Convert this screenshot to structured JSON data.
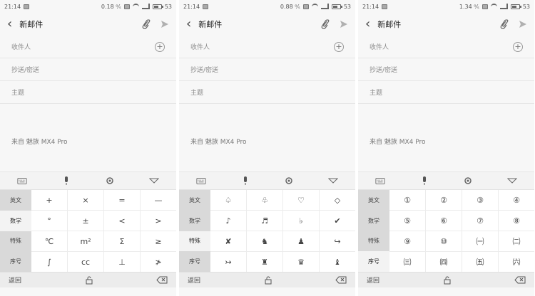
{
  "screens": [
    {
      "status": {
        "time": "21:14",
        "speed": "0.18 ⁰⁄ₛ",
        "battery": "53"
      },
      "header": {
        "title": "新邮件"
      },
      "fields": {
        "to_label": "收件人",
        "cc_label": "抄送/密送",
        "subject_label": "主题"
      },
      "signature": "来自 魅族 MX4 Pro",
      "categories": [
        "英文",
        "数学",
        "特殊",
        "序号"
      ],
      "active_category": 1,
      "keys": [
        "+",
        "×",
        "=",
        "—",
        "°",
        "±",
        "<",
        ">",
        "℃",
        "m²",
        "Σ",
        "≥",
        "∫",
        "cc",
        "⊥",
        "≯"
      ],
      "bottom": {
        "back": "返回"
      },
      "icons": {
        "keyboard": "keyboard-icon",
        "mic": "microphone-icon",
        "settings": "gear-icon",
        "collapse": "chevron-down-icon",
        "lock": "lock-icon",
        "delete": "backspace-icon",
        "attach": "paperclip-icon",
        "send": "send-icon",
        "add": "plus-circle-icon"
      }
    },
    {
      "status": {
        "time": "21:14",
        "speed": "0.88 ⁰⁄ₛ",
        "battery": "53"
      },
      "header": {
        "title": "新邮件"
      },
      "fields": {
        "to_label": "收件人",
        "cc_label": "抄送/密送",
        "subject_label": "主题"
      },
      "signature": "来自 魅族 MX4 Pro",
      "categories": [
        "英文",
        "数学",
        "特殊",
        "序号"
      ],
      "active_category": 2,
      "keys": [
        "♤",
        "♧",
        "♡",
        "◇",
        "♪",
        "♬",
        "♭",
        "✔",
        "✘",
        "♞",
        "♟",
        "↪",
        "↣",
        "♜",
        "♛",
        "♝"
      ],
      "bottom": {
        "back": "返回"
      },
      "icons": {
        "keyboard": "keyboard-icon",
        "mic": "microphone-icon",
        "settings": "gear-icon",
        "collapse": "chevron-down-icon",
        "lock": "lock-icon",
        "delete": "backspace-icon",
        "attach": "paperclip-icon",
        "send": "send-icon",
        "add": "plus-circle-icon"
      }
    },
    {
      "status": {
        "time": "21:14",
        "speed": "1.34 ⁰⁄ₛ",
        "battery": "53"
      },
      "header": {
        "title": "新邮件"
      },
      "fields": {
        "to_label": "收件人",
        "cc_label": "抄送/密送",
        "subject_label": "主题"
      },
      "signature": "来自 魅族 MX4 Pro",
      "categories": [
        "英文",
        "数学",
        "特殊",
        "序号"
      ],
      "active_category": 3,
      "keys": [
        "①",
        "②",
        "③",
        "④",
        "⑤",
        "⑥",
        "⑦",
        "⑧",
        "⑨",
        "⑩",
        "㈠",
        "㈡",
        "㈢",
        "㈣",
        "㈤",
        "㈥"
      ],
      "bottom": {
        "back": "返回"
      },
      "icons": {
        "keyboard": "keyboard-icon",
        "mic": "microphone-icon",
        "settings": "gear-icon",
        "collapse": "chevron-down-icon",
        "lock": "lock-icon",
        "delete": "backspace-icon",
        "attach": "paperclip-icon",
        "send": "send-icon",
        "add": "plus-circle-icon"
      }
    }
  ]
}
